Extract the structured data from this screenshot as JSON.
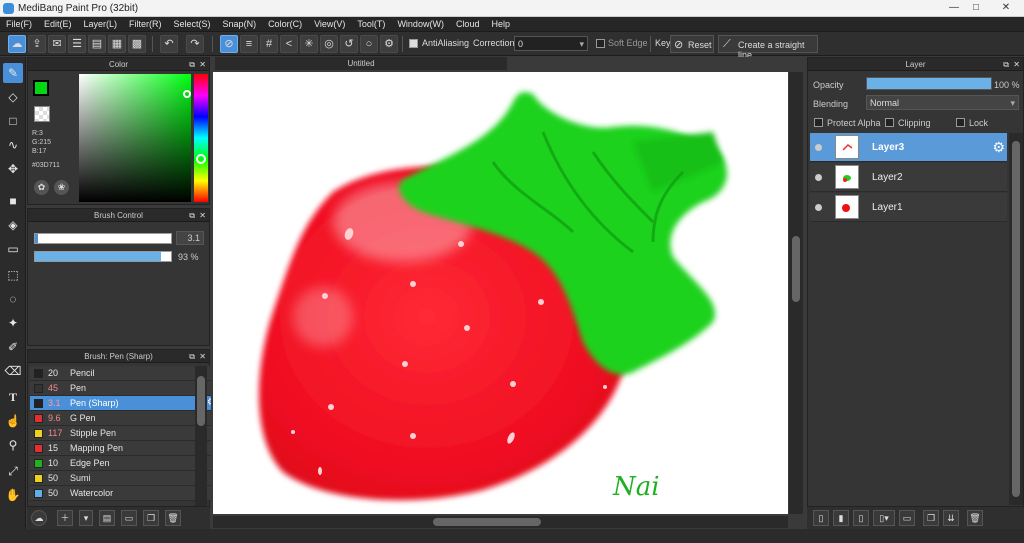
{
  "app": {
    "title": "MediBang Paint Pro (32bit)",
    "win_min": "—",
    "win_max": "□",
    "win_close": "✕"
  },
  "menu": [
    "File(F)",
    "Edit(E)",
    "Layer(L)",
    "Filter(R)",
    "Select(S)",
    "Snap(N)",
    "Color(C)",
    "View(V)",
    "Tool(T)",
    "Window(W)",
    "Cloud",
    "Help"
  ],
  "toolbar": {
    "antialiasing": "AntiAliasing",
    "correction_label": "Correction",
    "correction_value": "0",
    "soft_edge": "Soft Edge",
    "key": "Key",
    "reset": "Reset",
    "straight_line": "Create a straight line"
  },
  "color_panel": {
    "title": "Color",
    "r": "R:3",
    "g": "G:215",
    "b": "B:17",
    "hex": "#03D711",
    "fg": "#03D711",
    "bg": "#000000"
  },
  "brush_control": {
    "title": "Brush Control",
    "size": "3.1",
    "opacity": "93 %",
    "opacity_fraction": 0.93
  },
  "brush_list": {
    "title": "Brush: Pen (Sharp)",
    "items": [
      {
        "size": "20",
        "name": "Pencil",
        "color": "#222222"
      },
      {
        "size": "45",
        "name": "Pen",
        "color": "#333333"
      },
      {
        "size": "3.1",
        "name": "Pen (Sharp)",
        "color": "#222222"
      },
      {
        "size": "9.6",
        "name": "G Pen",
        "color": "#e03030"
      },
      {
        "size": "117",
        "name": "Stipple Pen",
        "color": "#f0d020"
      },
      {
        "size": "15",
        "name": "Mapping Pen",
        "color": "#e03030"
      },
      {
        "size": "10",
        "name": "Edge Pen",
        "color": "#20b020"
      },
      {
        "size": "50",
        "name": "Sumi",
        "color": "#f0d020"
      },
      {
        "size": "50",
        "name": "Watercolor",
        "color": "#60b0e8"
      }
    ]
  },
  "canvas": {
    "tab": "Untitled",
    "signature": "Nai"
  },
  "layer_panel": {
    "title": "Layer",
    "opacity_label": "Opacity",
    "opacity_value": "100 %",
    "opacity_fraction": 1.0,
    "blending_label": "Blending",
    "blending_value": "Normal",
    "protect_alpha": "Protect Alpha",
    "clipping": "Clipping",
    "lock": "Lock",
    "layers": [
      {
        "name": "Layer3"
      },
      {
        "name": "Layer2"
      },
      {
        "name": "Layer1"
      }
    ]
  }
}
